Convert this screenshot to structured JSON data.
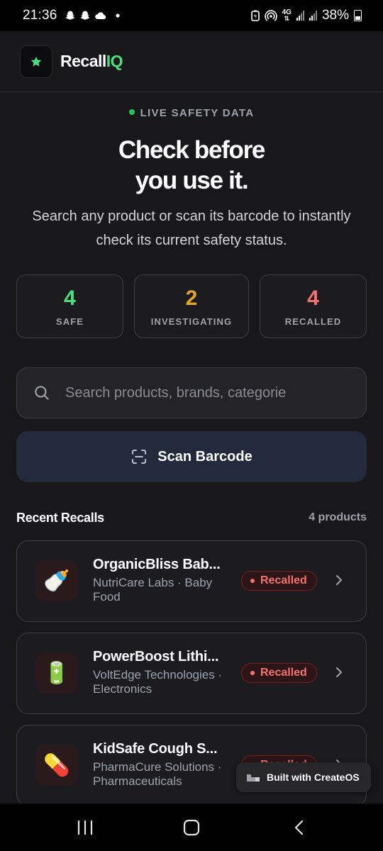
{
  "status_bar": {
    "time": "21:36",
    "network": "4G",
    "battery": "38%",
    "icons": [
      "snapchat-icon",
      "snapchat-icon",
      "cloud-icon",
      "dot-icon",
      "battery-saver-icon",
      "hotspot-icon",
      "signal-icon",
      "signal-icon",
      "battery-icon"
    ]
  },
  "header": {
    "logo_icon": "star-icon",
    "brand_part1": "Recall",
    "brand_part2": "IQ",
    "accent_color": "#4ade80"
  },
  "hero": {
    "live_label": "LIVE SAFETY DATA",
    "title_line1": "Check before",
    "title_line2": "you use it.",
    "subtitle": "Search any product or scan its barcode to instantly check its current safety status."
  },
  "stats": [
    {
      "value": "4",
      "label": "SAFE",
      "color": "#4ade80"
    },
    {
      "value": "2",
      "label": "INVESTIGATING",
      "color": "#e5a422"
    },
    {
      "value": "4",
      "label": "RECALLED",
      "color": "#f87171"
    }
  ],
  "search": {
    "placeholder": "Search products, brands, categorie",
    "icon": "search-icon"
  },
  "scan": {
    "label": "Scan Barcode",
    "icon": "barcode-scan-icon"
  },
  "recent": {
    "title": "Recent Recalls",
    "count": "4 products",
    "items": [
      {
        "name": "OrganicBliss Bab...",
        "meta": "NutriCare Labs · Baby Food",
        "emoji": "🍼",
        "icon": "baby-bottle-icon",
        "status": "Recalled"
      },
      {
        "name": "PowerBoost Lithi...",
        "meta": "VoltEdge Technologies · Electronics",
        "emoji": "🔋",
        "icon": "battery-icon",
        "status": "Recalled"
      },
      {
        "name": "KidSafe Cough S...",
        "meta": "PharmaCure Solutions · Pharmaceuticals",
        "emoji": "💊",
        "icon": "pill-icon",
        "status": "Recalled"
      }
    ]
  },
  "badge_widget": {
    "label": "Built with CreateOS",
    "icon": "createos-logo-icon"
  },
  "nav": {
    "icons": [
      "recent-apps-icon",
      "home-icon",
      "back-icon"
    ]
  }
}
